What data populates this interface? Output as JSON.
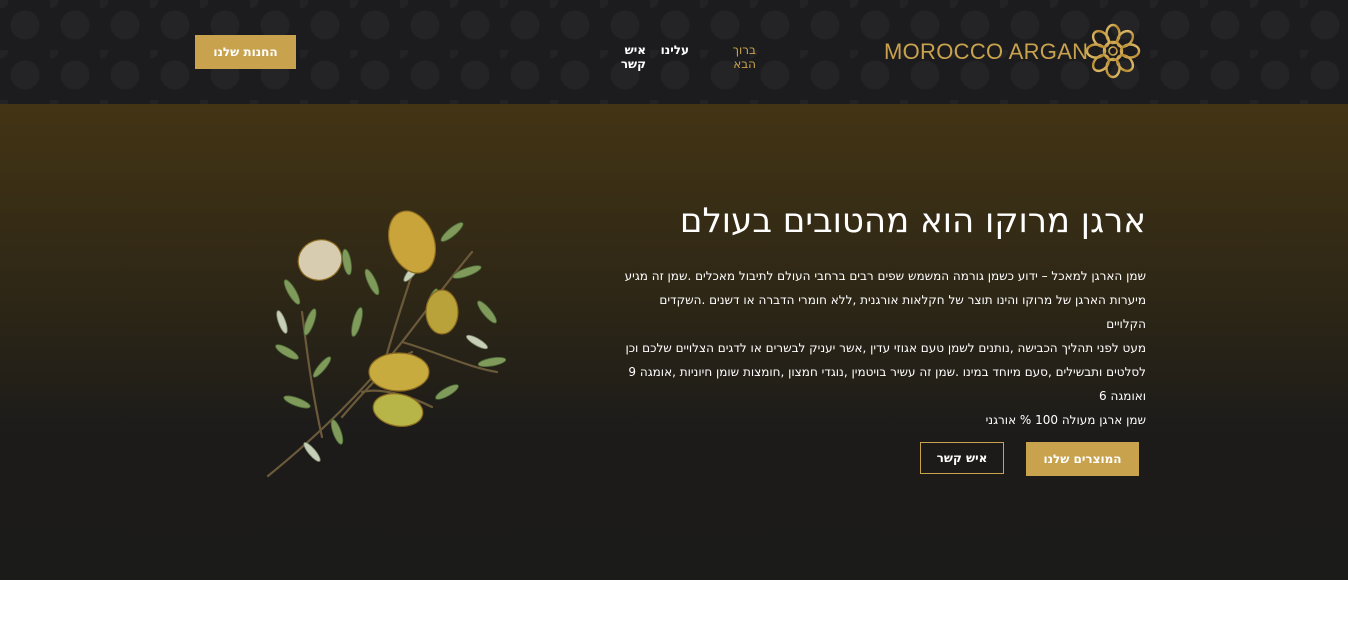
{
  "brand": {
    "name": "MOROCCO ARGAN",
    "color": "#c9a24d"
  },
  "nav": {
    "items": [
      {
        "label": "ברוך הבא",
        "active": true
      },
      {
        "label": "עלינו",
        "active": false
      },
      {
        "label": "איש קשר",
        "active": false
      }
    ]
  },
  "header": {
    "store_button": "החנות שלנו"
  },
  "hero": {
    "title": "ארגן מרוקו הוא מהטובים בעולם",
    "paragraph_lines": [
      "שמן הארגן למאכל – ידוע כשמן גורמה המשמש שפים רבים ברחבי העולם לתיבול מאכלים .שמן זה מגיע",
      "מיערות הארגן של מרוקו והינו תוצר של חקלאות אורגנית ,ללא חומרי הדברה או דשנים .השקדים הקלויים",
      "מעט לפני תהליך הכבישה ,נותנים לשמן טעם אגוזי עדין ,אשר יעניק לבשרים או לדגים הצלויים שלכם וכן",
      "לסלטים ותבשילים ,סעם מיוחד במינו .שמן זה עשיר בויטמין ,נוגדי חמצון ,חומצות שומן חיוניות ,אומגה 9",
      "ואומגה 6"
    ],
    "tagline": "שמן ארגן מעולה 100 % אורגני",
    "products_button": "המוצרים שלנו",
    "contact_button": "איש קשר",
    "illustration": "argan-branch-illustration"
  },
  "colors": {
    "accent": "#c9a24d",
    "header_bg": "#1c1c1e",
    "hero_top": "#433414",
    "hero_bottom": "#1b1b1a"
  }
}
